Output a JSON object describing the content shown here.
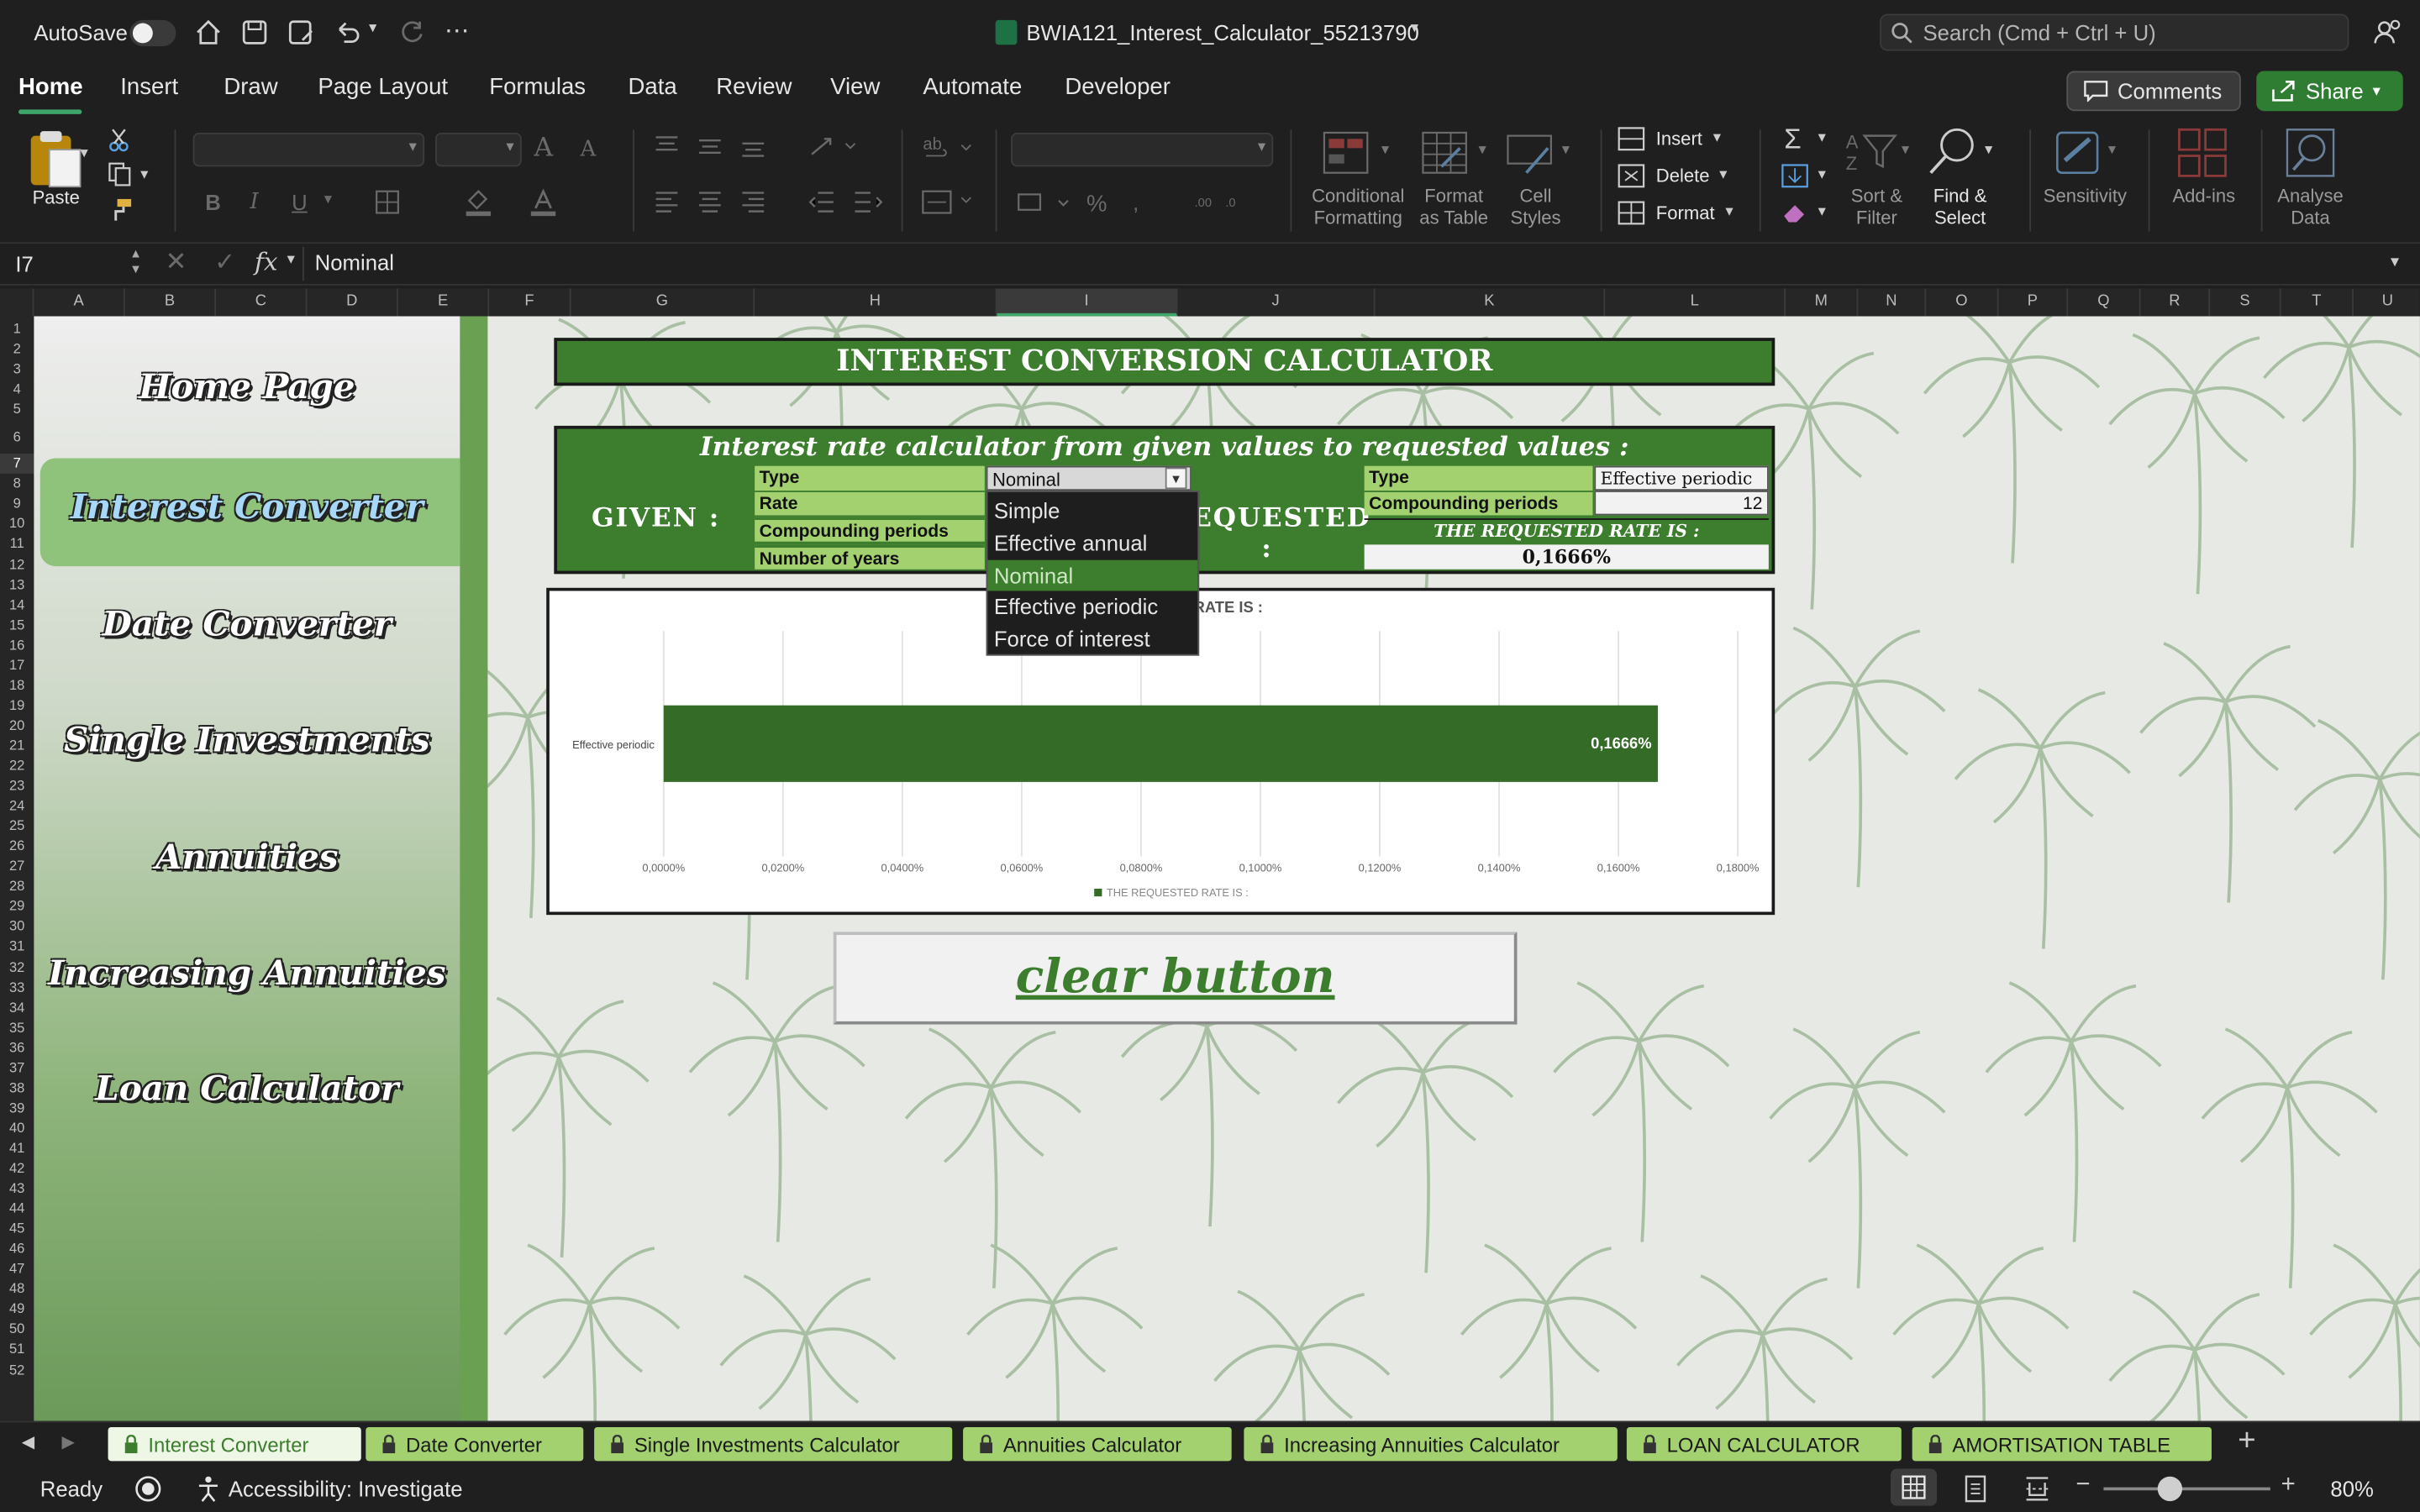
{
  "titlebar": {
    "autosave_label": "AutoSave",
    "file_name": "BWIA121_Interest_Calculator_55213790",
    "search_placeholder": "Search (Cmd + Ctrl + U)"
  },
  "ribbon_tabs": [
    "Home",
    "Insert",
    "Draw",
    "Page Layout",
    "Formulas",
    "Data",
    "Review",
    "View",
    "Automate",
    "Developer"
  ],
  "comments_label": "Comments",
  "share_label": "Share",
  "ribbon": {
    "paste": "Paste",
    "insert": "Insert",
    "delete": "Delete",
    "format": "Format",
    "conditional_formatting": [
      "Conditional",
      "Formatting"
    ],
    "format_as_table": [
      "Format",
      "as Table"
    ],
    "cell_styles": [
      "Cell",
      "Styles"
    ],
    "sort_filter": [
      "Sort &",
      "Filter"
    ],
    "find_select": [
      "Find &",
      "Select"
    ],
    "sensitivity": "Sensitivity",
    "add_ins": "Add-ins",
    "analyse_data": [
      "Analyse",
      "Data"
    ],
    "bold": "B",
    "italic": "I",
    "underline": "U"
  },
  "formula_bar": {
    "cell_ref": "I7",
    "fx": "fx",
    "value": "Nominal"
  },
  "columns": [
    "A",
    "B",
    "C",
    "D",
    "E",
    "F",
    "G",
    "H",
    "I",
    "J",
    "K",
    "L",
    "M",
    "N",
    "O",
    "P",
    "Q",
    "R",
    "S",
    "T",
    "U"
  ],
  "rows": [
    "1",
    "2",
    "3",
    "4",
    "5",
    "6",
    "7",
    "8",
    "9",
    "10",
    "11",
    "12",
    "13",
    "14",
    "15",
    "16",
    "17",
    "18",
    "19",
    "20",
    "21",
    "22",
    "23",
    "24",
    "25",
    "26",
    "27",
    "28",
    "29",
    "30",
    "31",
    "32",
    "33",
    "34",
    "35",
    "36",
    "37",
    "38",
    "39",
    "40",
    "41",
    "42",
    "43",
    "44",
    "45",
    "46",
    "47",
    "48",
    "49",
    "50",
    "51",
    "52"
  ],
  "nav": [
    "Home Page",
    "Interest Converter",
    "Date Converter",
    "Single Investments",
    "Annuities",
    "Increasing Annuities",
    "Loan Calculator"
  ],
  "calculator": {
    "title": "INTEREST CONVERSION CALCULATOR",
    "subtitle": "Interest rate calculator from given values to requested values :",
    "given_label": "GIVEN :",
    "requested_label": "REQUESTED :",
    "given_rows": [
      "Type",
      "Rate",
      "Compounding periods",
      "Number of years"
    ],
    "given_type_value": "Nominal",
    "requested_type_label": "Type",
    "requested_type_value": "Effective periodic",
    "requested_compounding_label": "Compounding periods",
    "requested_compounding_value": "12",
    "result_label": "THE REQUESTED RATE IS :",
    "result_value": "0,1666%"
  },
  "dropdown": {
    "options": [
      "Simple",
      "Effective annual",
      "Nominal",
      "Effective periodic",
      "Force of interest"
    ],
    "selected": "Nominal"
  },
  "chart_data": {
    "type": "bar",
    "orientation": "horizontal",
    "title": "THE REQUESTED RATE IS :",
    "categories": [
      "Effective periodic"
    ],
    "series": [
      {
        "name": "THE REQUESTED RATE IS :",
        "values": [
          0.1666
        ],
        "color": "#336b27"
      }
    ],
    "value_unit": "%",
    "data_labels": [
      "0,1666%"
    ],
    "xlim": [
      0,
      0.18
    ],
    "x_ticks": [
      "0,0000%",
      "0,0200%",
      "0,0400%",
      "0,0600%",
      "0,0800%",
      "0,1000%",
      "0,1200%",
      "0,1400%",
      "0,1600%",
      "0,1800%"
    ],
    "grid": true,
    "legend": "bottom"
  },
  "clear_button": "clear button",
  "sheet_tabs": [
    "Interest Converter",
    "Date Converter",
    "Single Investments Calculator",
    "Annuities Calculator",
    "Increasing Annuities Calculator",
    "LOAN CALCULATOR",
    "AMORTISATION TABLE"
  ],
  "status": {
    "ready": "Ready",
    "accessibility": "Accessibility: Investigate",
    "zoom": "80%"
  },
  "colors": {
    "accent": "#3c7d2e",
    "light_green": "#a3d16f",
    "share": "#2e7d32"
  }
}
